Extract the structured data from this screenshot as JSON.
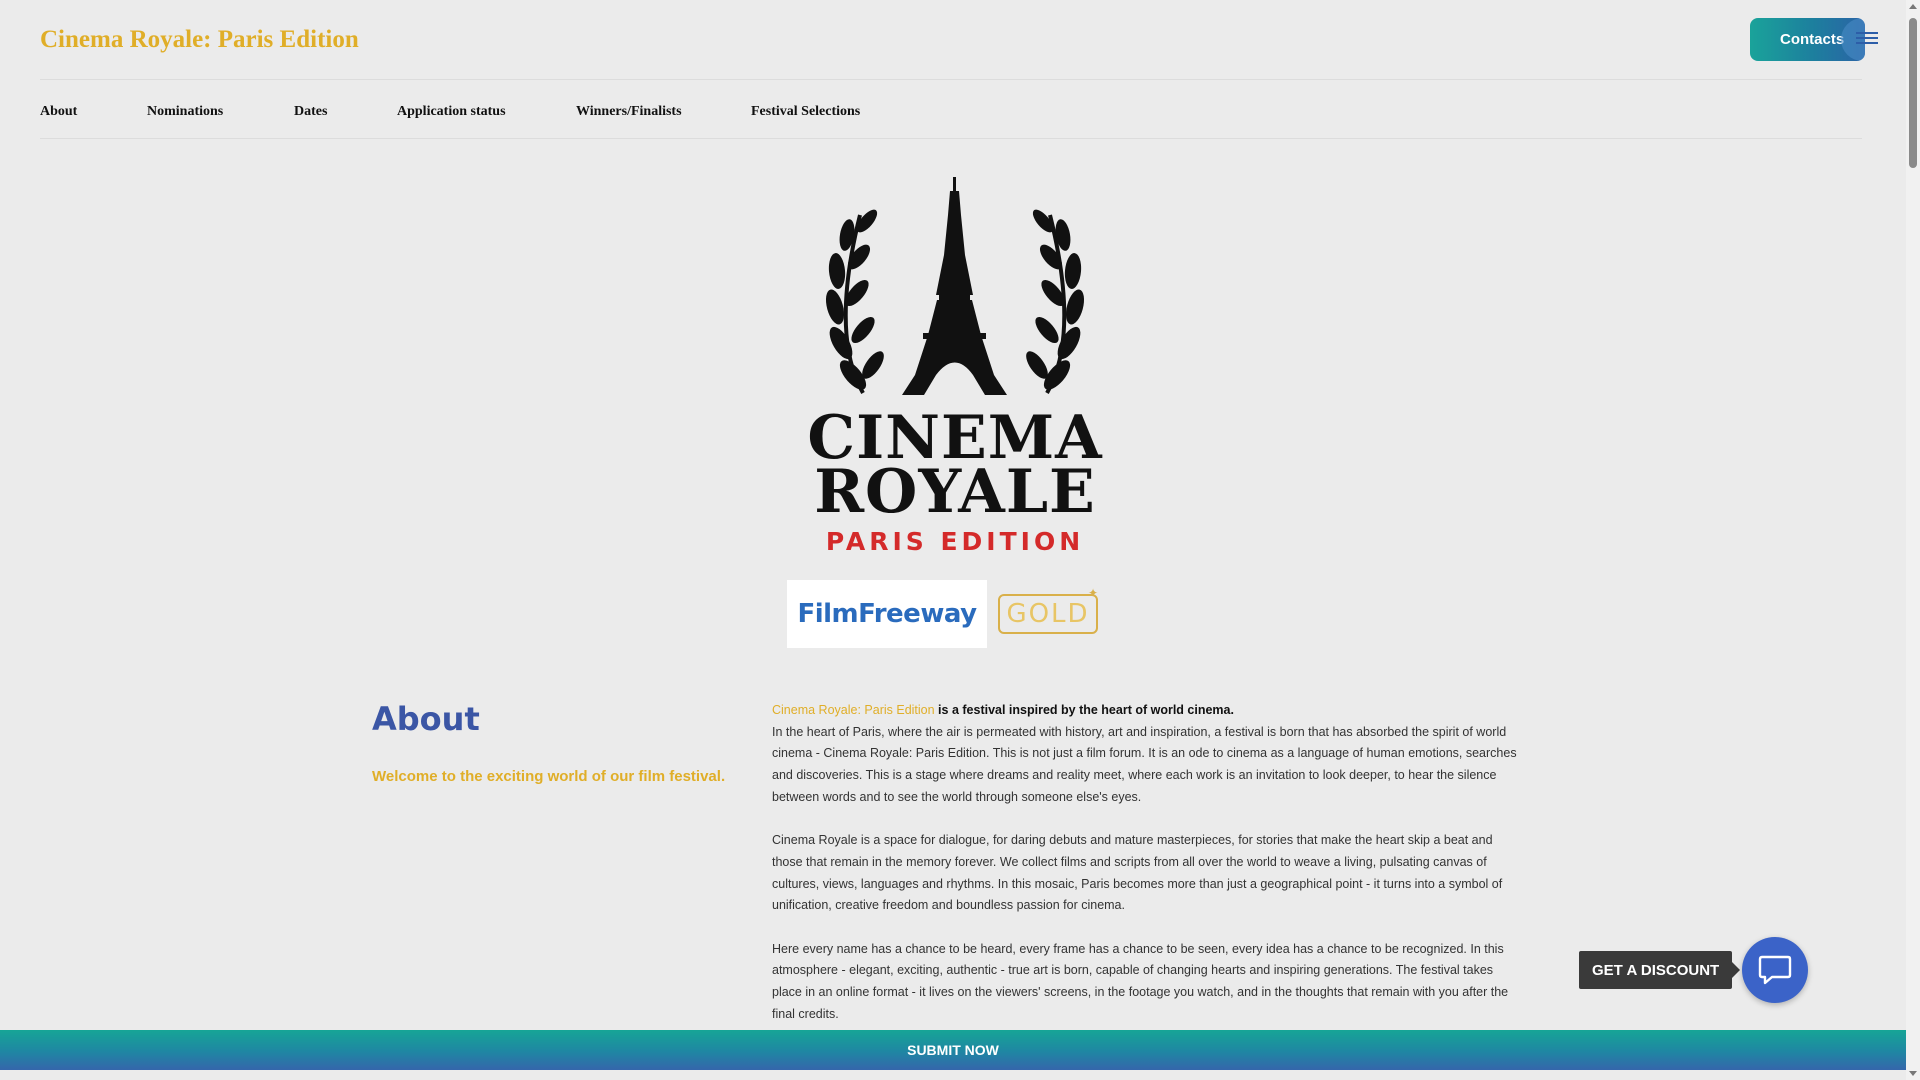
{
  "header": {
    "site_title": "Cinema Royale: Paris Edition",
    "contacts_label": "Contacts",
    "menu_icon": "hamburger-menu-icon"
  },
  "nav": {
    "items": [
      {
        "label": "About"
      },
      {
        "label": "Nominations"
      },
      {
        "label": "Dates"
      },
      {
        "label": "Application status"
      },
      {
        "label": "Winners/Finalists"
      },
      {
        "label": "Festival Selections"
      }
    ]
  },
  "logo": {
    "line1": "CINEMA",
    "line2": "ROYALE",
    "line3": "PARIS EDITION",
    "emblem": "eiffel-tower-laurel-icon",
    "text_color": "#111111",
    "accent_color": "#d42a2a"
  },
  "badges": {
    "filmfreeway": "FilmFreeway",
    "gold": "GOLD"
  },
  "about": {
    "heading": "About",
    "welcome": "Welcome to the exciting world of our film festival.",
    "lead_highlight": "Cinema Royale: Paris Edition",
    "lead_rest": " is a festival inspired by the heart of world cinema.",
    "paragraphs": [
      "In the heart of Paris, where the air is permeated with history, art and inspiration, a festival is born that has absorbed the spirit of world cinema - Cinema Royale: Paris Edition. This is not just a film forum. It is an ode to cinema as a language of human emotions, searches and discoveries. This is a stage where dreams and reality meet, where each work is an invitation to look deeper, to hear the silence between words and to see the world through someone else's eyes.",
      "Cinema Royale is a space for dialogue, for daring debuts and mature masterpieces, for stories that make the heart skip a beat and those that remain in the memory forever. We collect films and scripts from all over the world to weave a living, pulsating canvas of cultures, views, languages and rhythms. In this mosaic, Paris becomes more than just a geographical point - it turns into a symbol of unification, creative freedom and boundless passion for cinema.",
      "Here every name has a chance to be heard, every frame has a chance to be seen, every idea has a chance to be recognized. In this atmosphere - elegant, exciting, authentic - true art is born, capable of changing hearts and inspiring generations. The festival takes place in an online format - it lives on the viewers' screens, in the footage you watch, and in the thoughts that remain with you after the final credits."
    ]
  },
  "floating": {
    "discount_label": "GET A DISCOUNT",
    "chat_icon": "chat-bubble-icon"
  },
  "footer_bar": {
    "submit_label": "SUBMIT NOW"
  },
  "colors": {
    "brand_gold": "#e0ae28",
    "heading_blue": "#3b56a5",
    "teal": "#16a596",
    "background": "#ebebeb"
  }
}
